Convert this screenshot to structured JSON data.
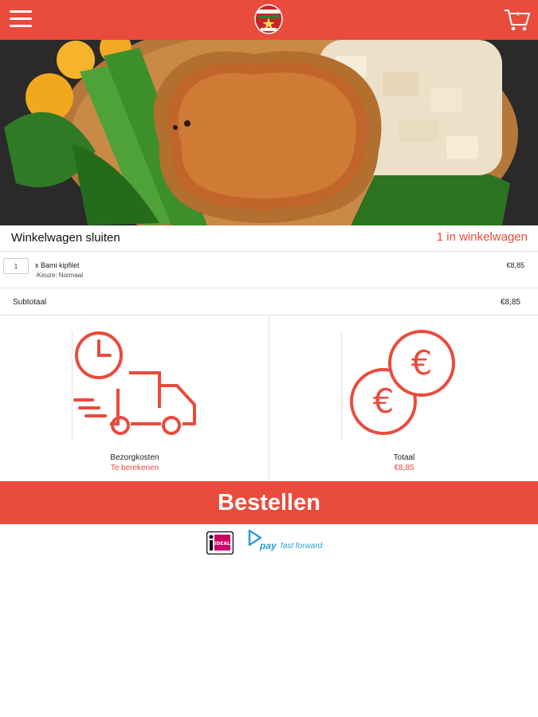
{
  "header": {
    "cart_count": "1",
    "brand_color": "#e94b3c"
  },
  "icons": {
    "menu": "hamburger-menu-icon",
    "logo": "restaurant-logo",
    "cart": "shopping-cart-icon",
    "delivery": "delivery-truck-clock-icon",
    "total": "euro-coins-icon",
    "ideal": "ideal-logo",
    "pay": "pay-fast-forward-logo"
  },
  "cart": {
    "close_label": "Winkelwagen sluiten",
    "count_label": "1 in winkelwagen"
  },
  "items": [
    {
      "quantity": "1",
      "name": "x Bami kipfilet",
      "option": "-Keuze: Normaal",
      "price": "€8,85"
    }
  ],
  "subtotal": {
    "label": "Subtotaal",
    "value": "€8,85"
  },
  "summary": {
    "delivery_label": "Bezorgkosten",
    "delivery_value": "Te berekenen",
    "total_label": "Totaal",
    "total_value": "€8,85"
  },
  "order_button": "Bestellen",
  "payment": {
    "ideal_text": "iDEAL",
    "pay_text": "pay",
    "ff_text": "fast forward"
  }
}
